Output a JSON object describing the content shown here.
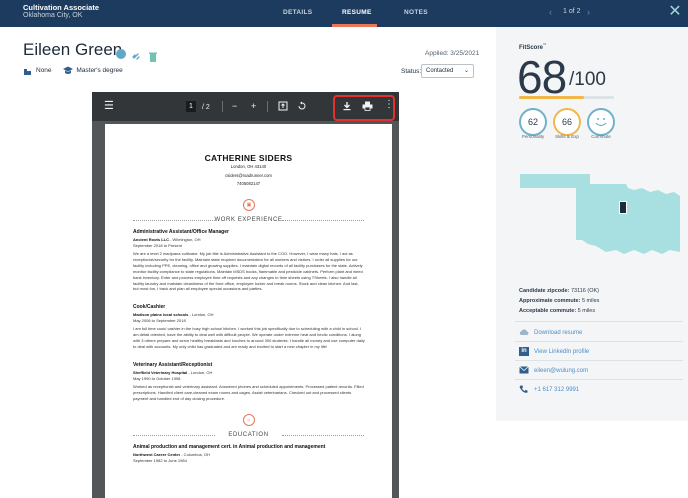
{
  "job": {
    "title": "Cultivation Associate",
    "location": "Oklahoma City, OK"
  },
  "tabs": [
    {
      "label": "DETAILS",
      "active": false
    },
    {
      "label": "RESUME",
      "active": true
    },
    {
      "label": "NOTES",
      "active": false
    }
  ],
  "pager": {
    "text": "1 of 2"
  },
  "candidate": {
    "name": "Eileen Green",
    "applied": "Applied: 3/25/2021",
    "relocation": "None",
    "education": "Master's degree",
    "status_label": "Status:",
    "status_value": "Contacted"
  },
  "viewer": {
    "current_page": "1",
    "total_pages": "/  2"
  },
  "resume": {
    "name": "CATHERINE SIDERS",
    "city": "London, OH 43140",
    "email": "csiders@roadrunner.com",
    "phone": "7405082147",
    "experience_title": "WORK EXPERIENCE",
    "jobs": [
      {
        "title": "Administrative Assistant/Office Manager",
        "employer": "Ancient Roots LLC",
        "place": " - Wilmington, OH",
        "dates": "September 2018 to Present",
        "desc": "We are a level 2 marijuana cultivator. My job title is Administrative Assistant to the COO. However, I wear many hats. I act as receptionist/security for the facility. Maintain state required documentation for all workers and visitors. I order all supplies for our facility including PPE, cleaning, office and growing supplies. I maintain digital records of all facility purchases for the state. Actively monitor facility compliance to state regulations. Maintain MSDS books, flammable and pesticide cabinets. Perform plant and weed bank inventory. Enter and process employee time off requests and any changes to time sheets using TSheets. I also handle all facility laundry and maintain cleanliness of the front office, employee locker and break rooms. Stock and clean kitchen. And last, but most fun, I track and plan all employee special occasions and parties."
      },
      {
        "title": "Cook/Cashier",
        "employer": "Madison plains local schools",
        "place": " - London, OH",
        "dates": "May 2006 to September 2018",
        "desc": "I am full time cook/ cashier in the busy high school kitchen. I worked this job specifically due to scheduling with a child in school. I am detail oriented, have the ability to deal well with difficult people. We operate under extreme heat and hectic conditions. I along with 3 others prepare and serve healthy breakfasts and lunches to around 300 students. I handle all money and use computer daily to deal with accounts. My only child has graduated and am ready and excited to start a new chapter in my life!"
      },
      {
        "title": "Veterinary Assistant/Receptionist",
        "employer": "Sheffield Veterinary Hospital",
        "place": " - London, OH",
        "dates": "May 1990 to October 1998",
        "desc": "Worked as receptionist and veterinary assistant. Answered phones and scheduled appointments. Processed patient records. Filled prescriptions. Handled client care,cleaned exam rooms and cages. Assist veterinarians. Checked out and processed clients payment and handled end of day closing procedure."
      }
    ],
    "education_title": "EDUCATION",
    "edu": {
      "title": "Animal production and management cert. in Animal production and management",
      "school": "Northwest Career Center",
      "place": " - Columbus, OH",
      "dates": "September 1982 to June 1984"
    }
  },
  "fitscore": {
    "label": "FitScore",
    "tm": "™",
    "score": "68",
    "out_of": "/100",
    "fill_fraction": 0.68,
    "bar_color": "#f0b74a",
    "subscores": [
      {
        "value": "62",
        "label": "Personality",
        "color": "#6fb1c9"
      },
      {
        "value": "66",
        "label": "Skills & Exp",
        "color": "#f0b74a"
      },
      {
        "value": "",
        "label": "Commute",
        "color": "#6fb1c9"
      }
    ]
  },
  "commute": {
    "zip_label": "Candidate zipcode:",
    "zip_value": " 73116 (OK)",
    "approx_label": "Approximate commute:",
    "approx_value": " 5 miles",
    "accept_label": "Acceptable commute:",
    "accept_value": " 5 miles"
  },
  "links": {
    "download": "Download resume",
    "linkedin": "View LinkedIn profile",
    "email": "eileen@wulung.com",
    "phone": "+1 617 312 9991"
  },
  "colors": {
    "header": "#1d3b5e",
    "accent": "#e8765b",
    "link": "#4d8fc9",
    "map": "#a8e0e2"
  }
}
